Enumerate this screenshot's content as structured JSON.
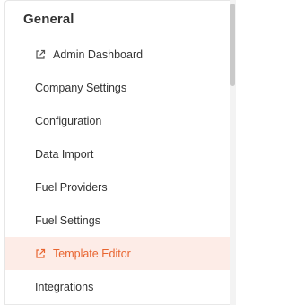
{
  "section": {
    "title": "General"
  },
  "menu": {
    "items": [
      {
        "label": "Admin Dashboard",
        "icon": "external-link-icon",
        "active": false
      },
      {
        "label": "Company Settings",
        "icon": null,
        "active": false
      },
      {
        "label": "Configuration",
        "icon": null,
        "active": false
      },
      {
        "label": "Data Import",
        "icon": null,
        "active": false
      },
      {
        "label": "Fuel Providers",
        "icon": null,
        "active": false
      },
      {
        "label": "Fuel Settings",
        "icon": null,
        "active": false
      },
      {
        "label": "Template Editor",
        "icon": "external-link-icon",
        "active": true
      },
      {
        "label": "Integrations",
        "icon": null,
        "active": false
      }
    ]
  },
  "colors": {
    "accent": "#e8642f",
    "active_bg": "#fdece7",
    "text": "#333333",
    "icon": "#555555"
  }
}
